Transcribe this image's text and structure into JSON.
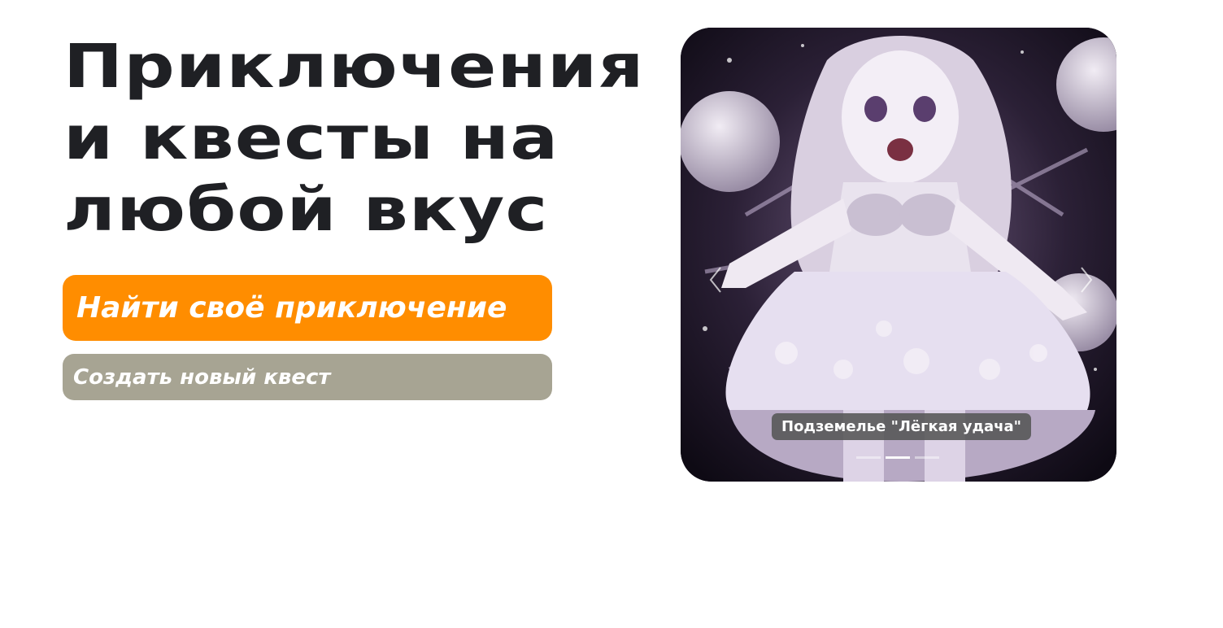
{
  "hero": {
    "title_lines": [
      "Приключения",
      "и квесты на",
      "любой вкус"
    ]
  },
  "actions": {
    "find_label": "Найти своё приключение",
    "create_label": "Создать новый квест",
    "find_color": "#ff8d00",
    "create_color": "#a7a493"
  },
  "carousel": {
    "caption": "Подземелье \"Лёгкая удача\"",
    "slides_count": 3,
    "active_slide": 2,
    "prev_icon": "chevron-left-icon",
    "next_icon": "chevron-right-icon"
  }
}
